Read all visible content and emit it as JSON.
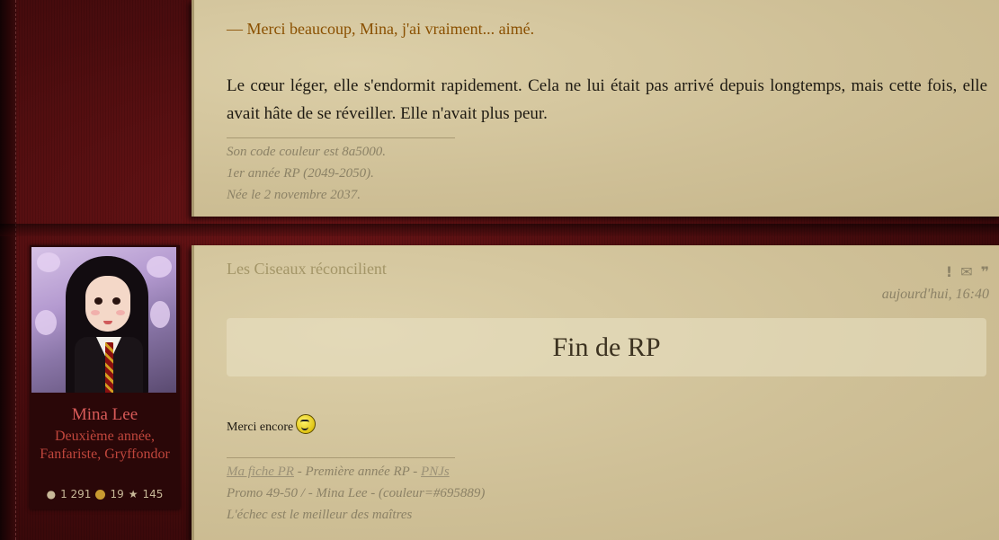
{
  "post1": {
    "dialogue": "— Merci beaucoup, Mina, j'ai vraiment... aimé.",
    "paragraph": "Le cœur léger, elle s'endormit rapidement. Cela ne lui était pas arrivé depuis longtemps, mais cette fois, elle avait hâte de se réveiller. Elle n'avait plus peur.",
    "signature": [
      "Son code couleur est 8a5000.",
      "1er année RP (2049-2050).",
      "Née le 2 novembre 2037."
    ]
  },
  "post2": {
    "title": "Les Ciseaux réconcilient",
    "timestamp": "aujourd'hui, 16:40",
    "icons": [
      "report-icon",
      "message-icon",
      "quote-icon"
    ],
    "banner": "Fin de RP",
    "message": "Merci encore",
    "signature": {
      "line1_link1": "Ma fiche PR",
      "line1_mid": " - Première année RP - ",
      "line1_link2": "PNJs",
      "line2": "Promo 49-50 / - Mina Lee - (couleur=#695889)",
      "line3": "L'échec est le meilleur des maîtres"
    }
  },
  "profile": {
    "name": "Mina Lee",
    "rank": "Deuxième année, Fanfariste, Gryffondor",
    "stats": {
      "messages": "1 291",
      "coins": "19",
      "stars": "145"
    }
  },
  "colors": {
    "dialogue": "#8a5000",
    "profile_name": "#d85a58",
    "panel_bg": "#d2c49c"
  }
}
